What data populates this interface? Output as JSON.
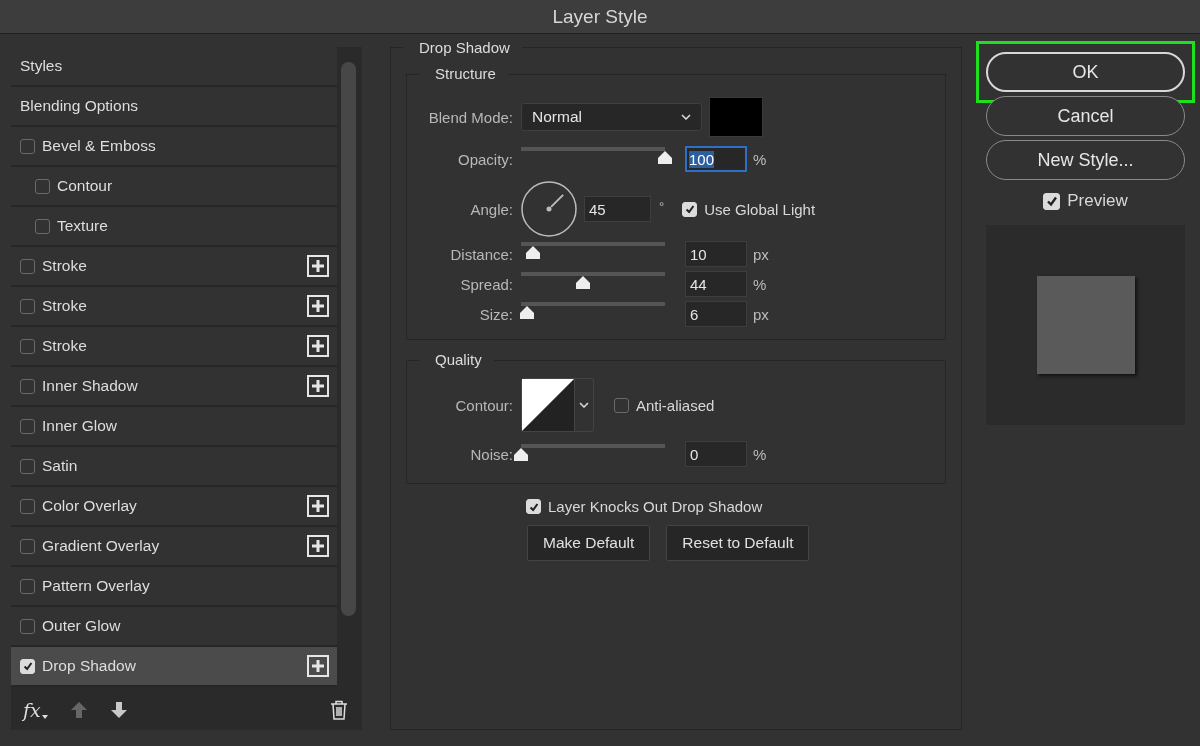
{
  "window": {
    "title": "Layer Style"
  },
  "styles_list": {
    "items": [
      {
        "label": "Styles",
        "kind": "header",
        "selected": false
      },
      {
        "label": "Blending Options",
        "kind": "header",
        "selected": false
      },
      {
        "label": "Bevel & Emboss",
        "kind": "effect",
        "checked": false,
        "add_button": false,
        "selected": false,
        "children": [
          {
            "label": "Contour",
            "kind": "effect",
            "checked": false,
            "add_button": false,
            "selected": false
          },
          {
            "label": "Texture",
            "kind": "effect",
            "checked": false,
            "add_button": false,
            "selected": false
          }
        ]
      },
      {
        "label": "Stroke",
        "kind": "effect",
        "checked": false,
        "add_button": true,
        "selected": false
      },
      {
        "label": "Stroke",
        "kind": "effect",
        "checked": false,
        "add_button": true,
        "selected": false
      },
      {
        "label": "Stroke",
        "kind": "effect",
        "checked": false,
        "add_button": true,
        "selected": false
      },
      {
        "label": "Inner Shadow",
        "kind": "effect",
        "checked": false,
        "add_button": true,
        "selected": false
      },
      {
        "label": "Inner Glow",
        "kind": "effect",
        "checked": false,
        "add_button": false,
        "selected": false
      },
      {
        "label": "Satin",
        "kind": "effect",
        "checked": false,
        "add_button": false,
        "selected": false
      },
      {
        "label": "Color Overlay",
        "kind": "effect",
        "checked": false,
        "add_button": true,
        "selected": false
      },
      {
        "label": "Gradient Overlay",
        "kind": "effect",
        "checked": false,
        "add_button": true,
        "selected": false
      },
      {
        "label": "Pattern Overlay",
        "kind": "effect",
        "checked": false,
        "add_button": false,
        "selected": false
      },
      {
        "label": "Outer Glow",
        "kind": "effect",
        "checked": false,
        "add_button": false,
        "selected": false
      },
      {
        "label": "Drop Shadow",
        "kind": "effect",
        "checked": true,
        "add_button": true,
        "selected": true
      }
    ]
  },
  "toolbar": {
    "fx_label": "fx",
    "move_up": {
      "disabled": true
    },
    "move_down": {
      "disabled": false
    }
  },
  "drop_shadow": {
    "title": "Drop Shadow",
    "structure": {
      "title": "Structure",
      "blend_mode": {
        "label": "Blend Mode:",
        "value": "Normal"
      },
      "opacity": {
        "label": "Opacity:",
        "level": 1.0,
        "value": "100",
        "unit": "%",
        "focused": true
      },
      "angle": {
        "label": "Angle:",
        "value": "45",
        "unit": "°",
        "use_global_light": {
          "label": "Use Global Light",
          "checked": true
        }
      },
      "sliders": [
        {
          "label": "Distance:",
          "level": 0.08,
          "value": "10",
          "unit": "px",
          "focused": false
        },
        {
          "label": "Spread:",
          "level": 0.43,
          "value": "44",
          "unit": "%",
          "focused": false
        },
        {
          "label": "Size:",
          "level": 0.04,
          "value": "6",
          "unit": "px",
          "focused": false
        }
      ]
    },
    "quality": {
      "title": "Quality",
      "contour_label": "Contour:",
      "anti_aliased": {
        "label": "Anti-aliased",
        "checked": false
      },
      "noise": {
        "label": "Noise:",
        "level": 0.0,
        "value": "0",
        "unit": "%",
        "focused": false
      }
    },
    "knockout": {
      "label": "Layer Knocks Out Drop Shadow",
      "checked": true
    },
    "buttons": [
      "Make Default",
      "Reset to Default"
    ]
  },
  "actions": {
    "buttons": [
      {
        "label": "OK",
        "highlighted": true
      },
      {
        "label": "Cancel",
        "highlighted": false
      },
      {
        "label": "New Style...",
        "highlighted": false
      }
    ],
    "preview": {
      "label": "Preview",
      "checked": true
    }
  }
}
